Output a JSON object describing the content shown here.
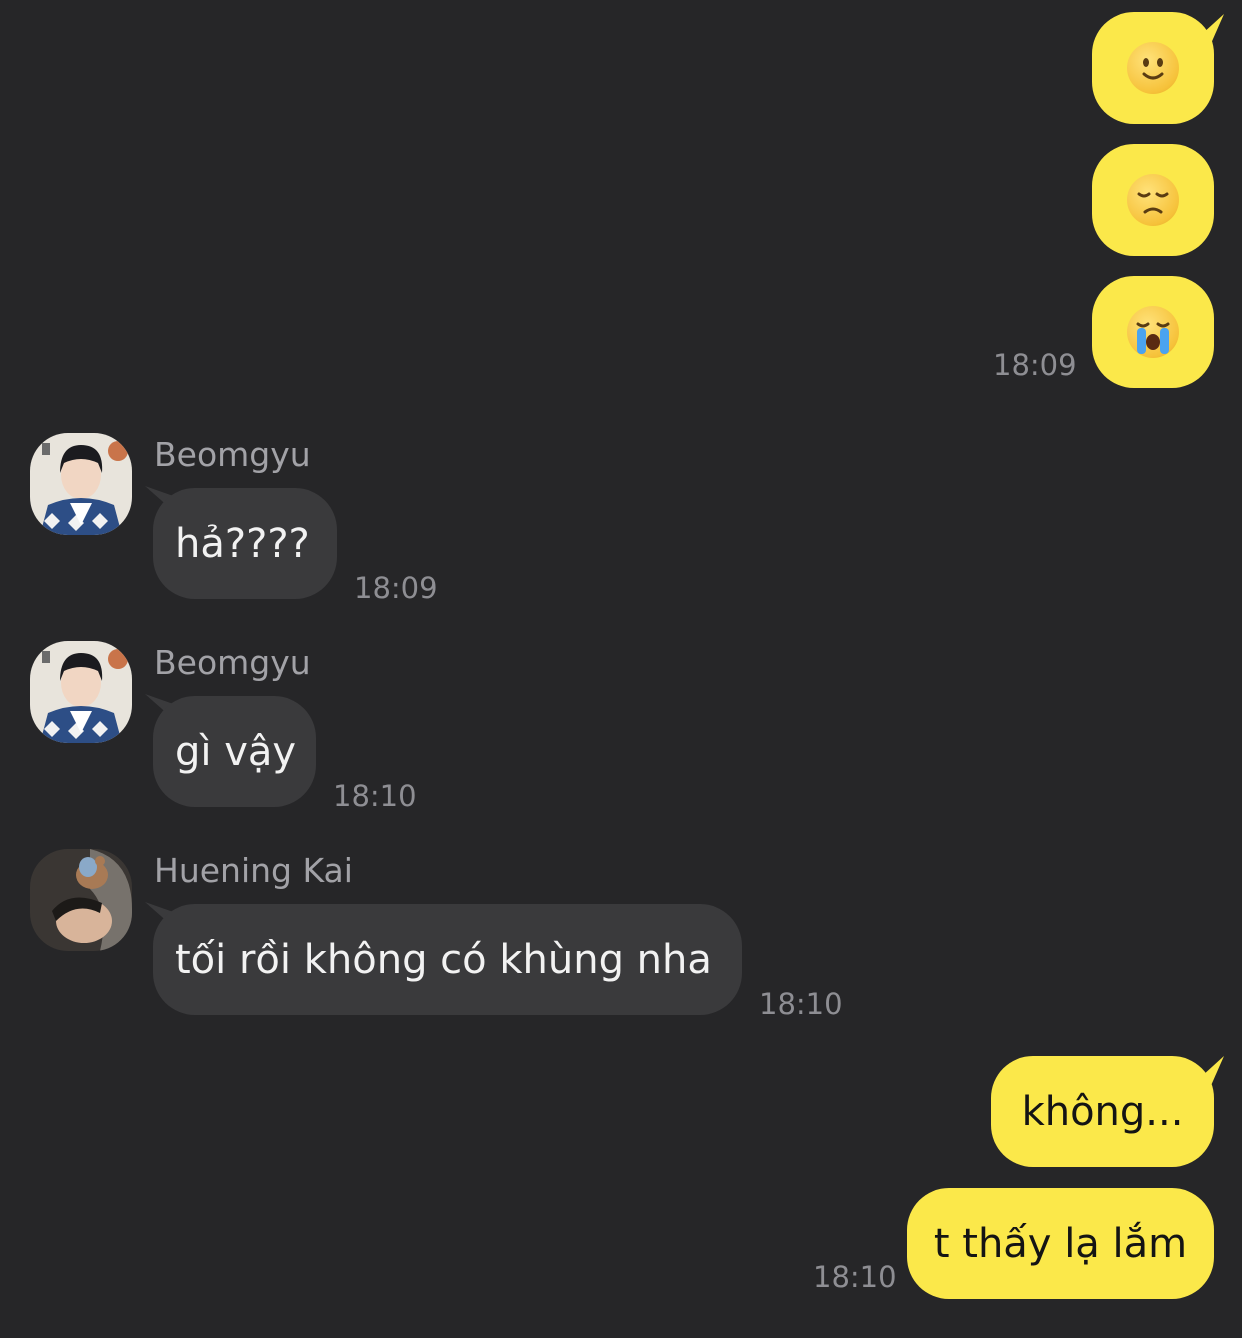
{
  "conversation": {
    "sent_group_1": {
      "emoji_1": "slightly-smiling-face",
      "emoji_2": "disappointed-face",
      "emoji_3": "loudly-crying-face",
      "time": "18:09"
    },
    "msg_beomgyu_1": {
      "sender": "Beomgyu",
      "text": "hả????",
      "time": "18:09"
    },
    "msg_beomgyu_2": {
      "sender": "Beomgyu",
      "text": "gì vậy",
      "time": "18:10"
    },
    "msg_hueningkai_1": {
      "sender": "Huening Kai",
      "text": "tối rồi không có khùng nha",
      "time": "18:10"
    },
    "sent_group_2": {
      "text_1": "không...",
      "text_2": "t thấy lạ lắm",
      "time": "18:10"
    }
  },
  "colors": {
    "background": "#262628",
    "sent_bubble": "#fbe84a",
    "received_bubble": "#3a3a3c",
    "timestamp": "#8e8e93"
  }
}
